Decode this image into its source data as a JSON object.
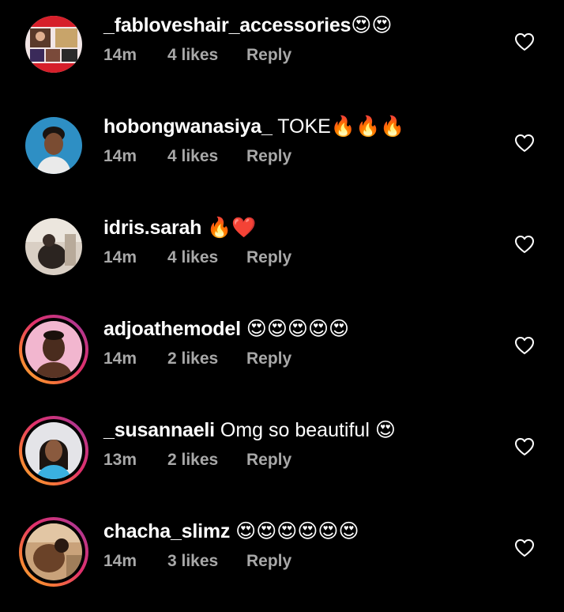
{
  "comments": [
    {
      "username": "_fabloveshair_accessories",
      "text": "😍😍",
      "time": "14m",
      "likes": "4 likes",
      "reply": "Reply",
      "story_ring": false
    },
    {
      "username": "hobongwanasiya_",
      "text": " TOKE🔥🔥🔥",
      "time": "14m",
      "likes": "4 likes",
      "reply": "Reply",
      "story_ring": false
    },
    {
      "username": "idris.sarah",
      "text": " 🔥❤️",
      "time": "14m",
      "likes": "4 likes",
      "reply": "Reply",
      "story_ring": false
    },
    {
      "username": "adjoathemodel",
      "text": " 😍😍😍😍😍",
      "time": "14m",
      "likes": "2 likes",
      "reply": "Reply",
      "story_ring": true
    },
    {
      "username": "_susannaeli",
      "text": " Omg so beautiful 😍",
      "time": "13m",
      "likes": "2 likes",
      "reply": "Reply",
      "story_ring": true
    },
    {
      "username": "chacha_slimz",
      "text": " 😍😍😍😍😍😍",
      "time": "14m",
      "likes": "3 likes",
      "reply": "Reply",
      "story_ring": true
    }
  ],
  "icons": {
    "like": "heart-outline-icon"
  },
  "colors": {
    "background": "#000000",
    "primary_text": "#ffffff",
    "secondary_text": "#a8a8a8",
    "story_ring_start": "#f7b733",
    "story_ring_end": "#c13584"
  }
}
